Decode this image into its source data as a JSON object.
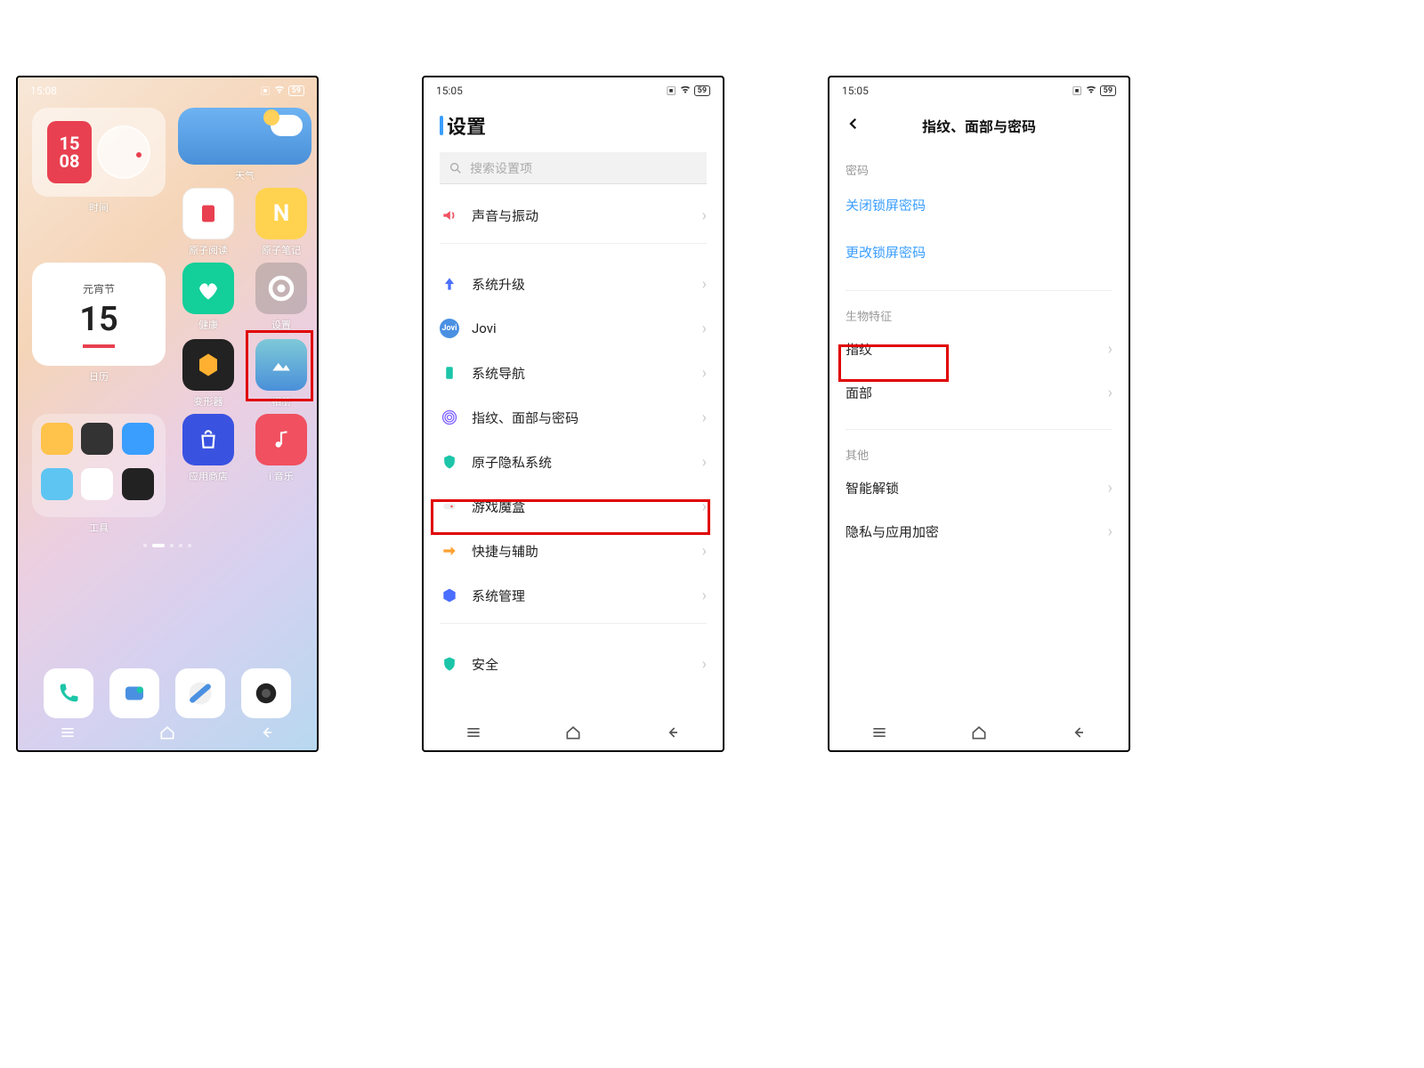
{
  "statusBar": {
    "time1": "15:08",
    "time2": "15:05",
    "time3": "15:05",
    "battery": "59"
  },
  "home": {
    "clock": {
      "hour": "15",
      "minute": "08"
    },
    "clockLabel": "时间",
    "weatherLabel": "天气",
    "calendar": {
      "title": "元宵节",
      "day": "15",
      "label": "日历"
    },
    "apps": {
      "reader": "原子阅读",
      "note": "原子笔记",
      "health": "健康",
      "settings": "设置",
      "transform": "变形器",
      "gallery": "相册",
      "appstore": "应用商店",
      "music": "i 音乐",
      "folder": "工具"
    }
  },
  "settings": {
    "title": "设置",
    "searchPlaceholder": "搜索设置项",
    "items": {
      "sound": "声音与振动",
      "upgrade": "系统升级",
      "jovi": "Jovi",
      "nav": "系统导航",
      "fingerprint": "指纹、面部与密码",
      "privacy": "原子隐私系统",
      "game": "游戏魔盒",
      "shortcut": "快捷与辅助",
      "sysmgmt": "系统管理",
      "security": "安全"
    }
  },
  "sub": {
    "title": "指纹、面部与密码",
    "sections": {
      "pwd": "密码",
      "bio": "生物特征",
      "other": "其他"
    },
    "items": {
      "closeLock": "关闭锁屏密码",
      "changeLock": "更改锁屏密码",
      "fingerprint": "指纹",
      "face": "面部",
      "smartUnlock": "智能解锁",
      "appEncrypt": "隐私与应用加密"
    }
  }
}
